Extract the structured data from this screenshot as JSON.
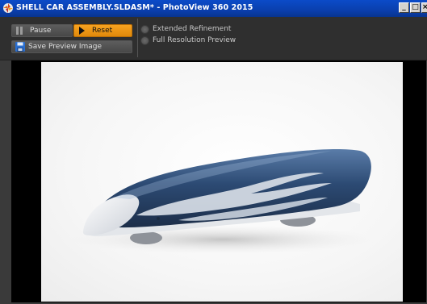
{
  "window": {
    "title": "SHELL CAR ASSEMBLY.SLDASM* - PhotoView 360 2015",
    "controls": {
      "minimize": "_",
      "restore": "□",
      "close": "×"
    }
  },
  "toolbar": {
    "pause_label": "Pause",
    "reset_label": "Reset",
    "save_preview_label": "Save Preview Image",
    "options": [
      {
        "label": "Extended Refinement",
        "checked": false
      },
      {
        "label": "Full Resolution Preview",
        "checked": false
      }
    ]
  },
  "colors": {
    "title_bar": "#0a3fae",
    "toolbar_bg": "#2f2f2f",
    "reset_accent": "#f7a21f",
    "car_body_blue": "#2c4a73",
    "car_flame": "#d7dde6"
  },
  "icons": {
    "app": "photoview-icon",
    "pause": "pause-icon",
    "reset": "play-icon",
    "save": "floppy-disk-icon"
  }
}
